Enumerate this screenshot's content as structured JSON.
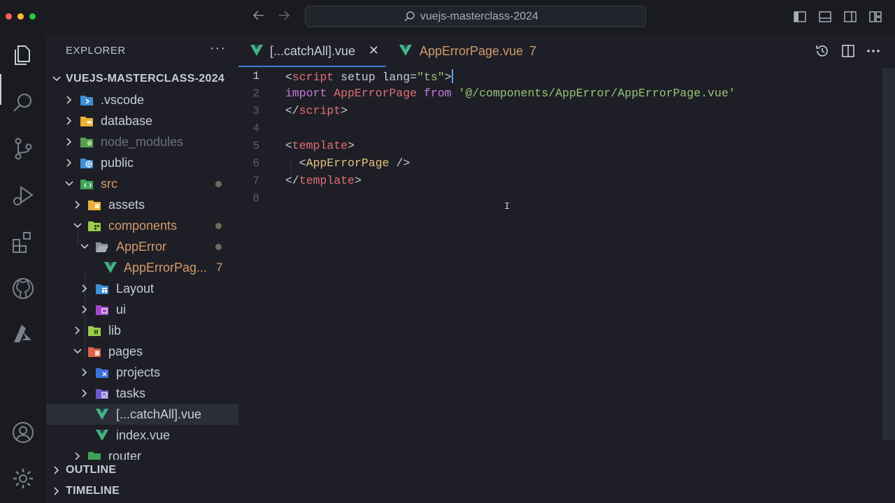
{
  "titlebar": {
    "search_text": "vuejs-masterclass-2024",
    "back_icon": "arrow-left-icon",
    "forward_icon": "arrow-right-icon"
  },
  "sidebar": {
    "title": "EXPLORER",
    "more": "···",
    "root": "VUEJS-MASTERCLASS-2024",
    "items": [
      {
        "label": ".vscode"
      },
      {
        "label": "database"
      },
      {
        "label": "node_modules"
      },
      {
        "label": "public"
      },
      {
        "label": "src"
      },
      {
        "label": "assets"
      },
      {
        "label": "components"
      },
      {
        "label": "AppError"
      },
      {
        "label": "AppErrorPag...",
        "problems": "7"
      },
      {
        "label": "Layout"
      },
      {
        "label": "ui"
      },
      {
        "label": "lib"
      },
      {
        "label": "pages"
      },
      {
        "label": "projects"
      },
      {
        "label": "tasks"
      },
      {
        "label": "[...catchAll].vue"
      },
      {
        "label": "index.vue"
      },
      {
        "label": "router"
      }
    ],
    "sections": [
      "OUTLINE",
      "TIMELINE"
    ]
  },
  "tabs": [
    {
      "label": "[...catchAll].vue",
      "close": "✕"
    },
    {
      "label": "AppErrorPage.vue",
      "problems": "7"
    }
  ],
  "editor": {
    "line_numbers": [
      "1",
      "2",
      "3",
      "4",
      "5",
      "6",
      "7",
      "8"
    ],
    "code": {
      "l1_open": "<",
      "l1_script": "script",
      "l1_attrs": " setup lang=",
      "l1_val": "\"ts\"",
      "l1_close": ">",
      "l2_import": "import",
      "l2_name": " AppErrorPage ",
      "l2_from": "from",
      "l2_path": " '@/components/AppError/AppErrorPage.vue'",
      "l3_open": "</",
      "l3_script": "script",
      "l3_close": ">",
      "l5_open": "<",
      "l5_template": "template",
      "l5_close": ">",
      "l6_open": "  <",
      "l6_comp": "AppErrorPage",
      "l6_close": " />",
      "l7_open": "</",
      "l7_template": "template",
      "l7_close": ">"
    }
  },
  "colors": {
    "accent": "#3b7dd8",
    "vue_green": "#41b883",
    "modified": "#d39a6a"
  }
}
